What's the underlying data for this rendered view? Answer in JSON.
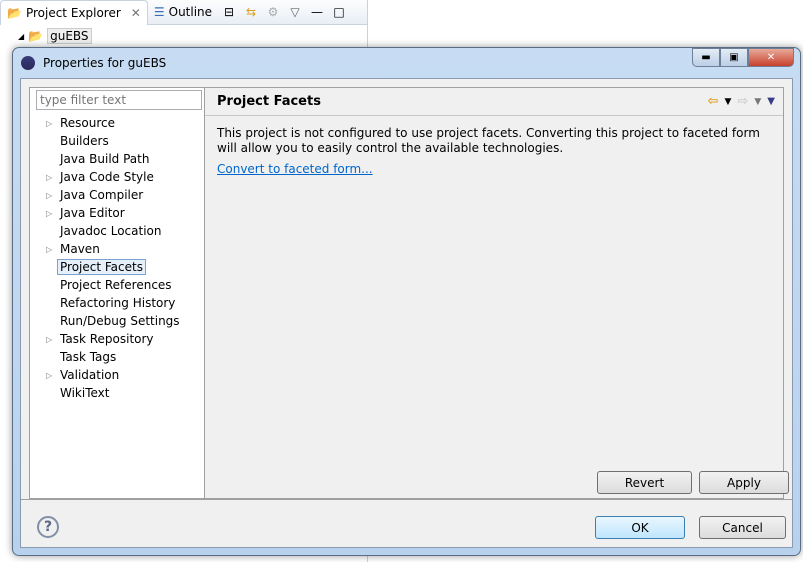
{
  "background_view": {
    "tabs": [
      {
        "label": "Project Explorer",
        "active": true
      },
      {
        "label": "Outline",
        "active": false
      }
    ],
    "tree_root": "guEBS"
  },
  "dialog": {
    "title": "Properties for guEBS",
    "filter_placeholder": "type filter text",
    "tree": [
      {
        "label": "Resource",
        "expandable": true
      },
      {
        "label": "Builders",
        "expandable": false
      },
      {
        "label": "Java Build Path",
        "expandable": false
      },
      {
        "label": "Java Code Style",
        "expandable": true
      },
      {
        "label": "Java Compiler",
        "expandable": true
      },
      {
        "label": "Java Editor",
        "expandable": true
      },
      {
        "label": "Javadoc Location",
        "expandable": false
      },
      {
        "label": "Maven",
        "expandable": true
      },
      {
        "label": "Project Facets",
        "expandable": false,
        "selected": true
      },
      {
        "label": "Project References",
        "expandable": false
      },
      {
        "label": "Refactoring History",
        "expandable": false
      },
      {
        "label": "Run/Debug Settings",
        "expandable": false
      },
      {
        "label": "Task Repository",
        "expandable": true
      },
      {
        "label": "Task Tags",
        "expandable": false
      },
      {
        "label": "Validation",
        "expandable": true
      },
      {
        "label": "WikiText",
        "expandable": false
      }
    ],
    "page": {
      "title": "Project Facets",
      "description": "This project is not configured to use project facets. Converting this project to faceted form will allow you to easily control the available technologies.",
      "link": "Convert to faceted form..."
    },
    "buttons": {
      "revert": "Revert",
      "apply": "Apply",
      "ok": "OK",
      "cancel": "Cancel"
    }
  }
}
